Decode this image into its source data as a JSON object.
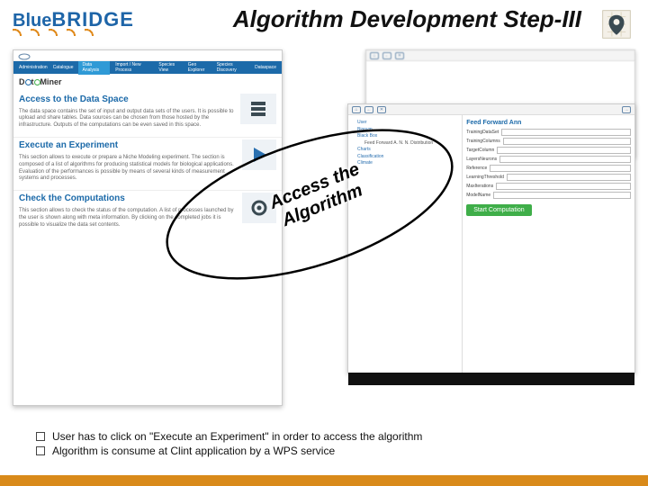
{
  "logo": {
    "blue": "Blue",
    "bridge": "BRIDGE"
  },
  "slide_title": "Algorithm Development Step-III",
  "annotation": "Access the Algorithm",
  "bullets": [
    "User has to click on \"Execute an Experiment\" in order to access the algorithm",
    "Algorithm is consume at Clint application by a WPS service"
  ],
  "dataminer": {
    "brand": "DataMiner",
    "nav": [
      "Administration",
      "Catalogue",
      "Data Analysis",
      "Import / New Process",
      "Species View",
      "Geo Explorer",
      "Species Discovery",
      "Dataspace"
    ],
    "sections": [
      {
        "title": "Access to the Data Space",
        "body": "The data space contains the set of input and output data sets of the users. It is possible to upload and share tables. Data sources can be chosen from those hosted by the infrastructure. Outputs of the computations can be even saved in this space."
      },
      {
        "title": "Execute an Experiment",
        "body": "This section allows to execute or prepare a Niche Modeling experiment. The section is composed of a list of algorithms for producing statistical models for biological applications. Evaluation of the performances is possible by means of several kinds of measurement systems and processes."
      },
      {
        "title": "Check the Computations",
        "body": "This section allows to check the status of the computation. A list of processes launched by the user is shown along with meta information. By clicking on the completed jobs it is possible to visualize the data set contents."
      }
    ]
  },
  "experiment_panel": {
    "toolbar_items": [
      "home",
      "back",
      "remove",
      "go-to"
    ],
    "tree": {
      "root": "User",
      "children": [
        "Bionym",
        {
          "label": "Black Box",
          "children": [
            "Feed Forward A. N. N. Distribution"
          ]
        },
        "Charts",
        "Classification",
        "Climate"
      ]
    },
    "form": {
      "title": "Feed Forward Ann",
      "fields": [
        {
          "label": "TrainingDataSet",
          "value": ""
        },
        {
          "label": "TrainingColumns",
          "value": ""
        },
        {
          "label": "TargetColumn",
          "value": ""
        },
        {
          "label": "LayersNeurons",
          "value": ""
        },
        {
          "label": "Reference",
          "value": ""
        },
        {
          "label": "LearningThreshold",
          "value": ""
        },
        {
          "label": "MaxIterations",
          "value": ""
        },
        {
          "label": "ModelName",
          "value": ""
        }
      ],
      "button": "Start Computation"
    }
  }
}
